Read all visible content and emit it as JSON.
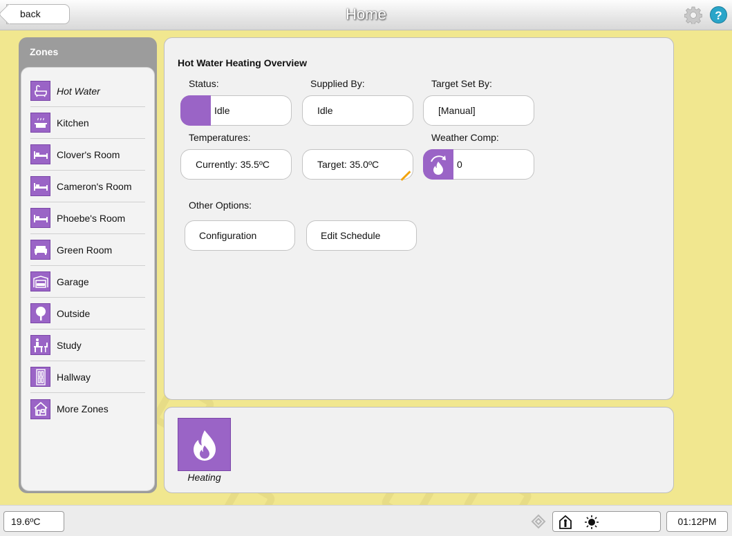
{
  "header": {
    "back_label": "back",
    "title": "Home",
    "help_glyph": "?"
  },
  "sidebar": {
    "title": "Zones",
    "items": [
      {
        "label": "Hot Water",
        "icon": "bathtub-icon",
        "active": true
      },
      {
        "label": "Kitchen",
        "icon": "stove-pot-icon"
      },
      {
        "label": "Clover's Room",
        "icon": "bed-icon"
      },
      {
        "label": "Cameron's Room",
        "icon": "bed-icon"
      },
      {
        "label": "Phoebe's Room",
        "icon": "bed-icon"
      },
      {
        "label": "Green Room",
        "icon": "sofa-icon"
      },
      {
        "label": "Garage",
        "icon": "car-icon"
      },
      {
        "label": "Outside",
        "icon": "tree-icon"
      },
      {
        "label": "Study",
        "icon": "desk-chair-icon"
      },
      {
        "label": "Hallway",
        "icon": "door-icon"
      },
      {
        "label": "More Zones",
        "icon": "house-icon"
      }
    ]
  },
  "overview": {
    "title": "Hot Water Heating Overview",
    "status_label": "Status:",
    "status_value": "Idle",
    "supplied_label": "Supplied By:",
    "supplied_value": "Idle",
    "target_set_label": "Target Set By:",
    "target_set_value": "[Manual]",
    "temperatures_label": "Temperatures:",
    "current_temp": "Currently: 35.5ºC",
    "target_temp": "Target: 35.0ºC",
    "weather_comp_label": "Weather Comp:",
    "weather_comp_value": "0",
    "other_options_label": "Other Options:",
    "configuration_button": "Configuration",
    "edit_schedule_button": "Edit Schedule"
  },
  "lower": {
    "heating_label": "Heating"
  },
  "footer": {
    "temperature": "19.6ºC",
    "time": "01:12PM"
  },
  "colors": {
    "accent_purple": "#9a64c6",
    "background_yellow": "#f1e78f",
    "edit_orange": "#f2a40f",
    "help_blue": "#2aa5c9"
  }
}
